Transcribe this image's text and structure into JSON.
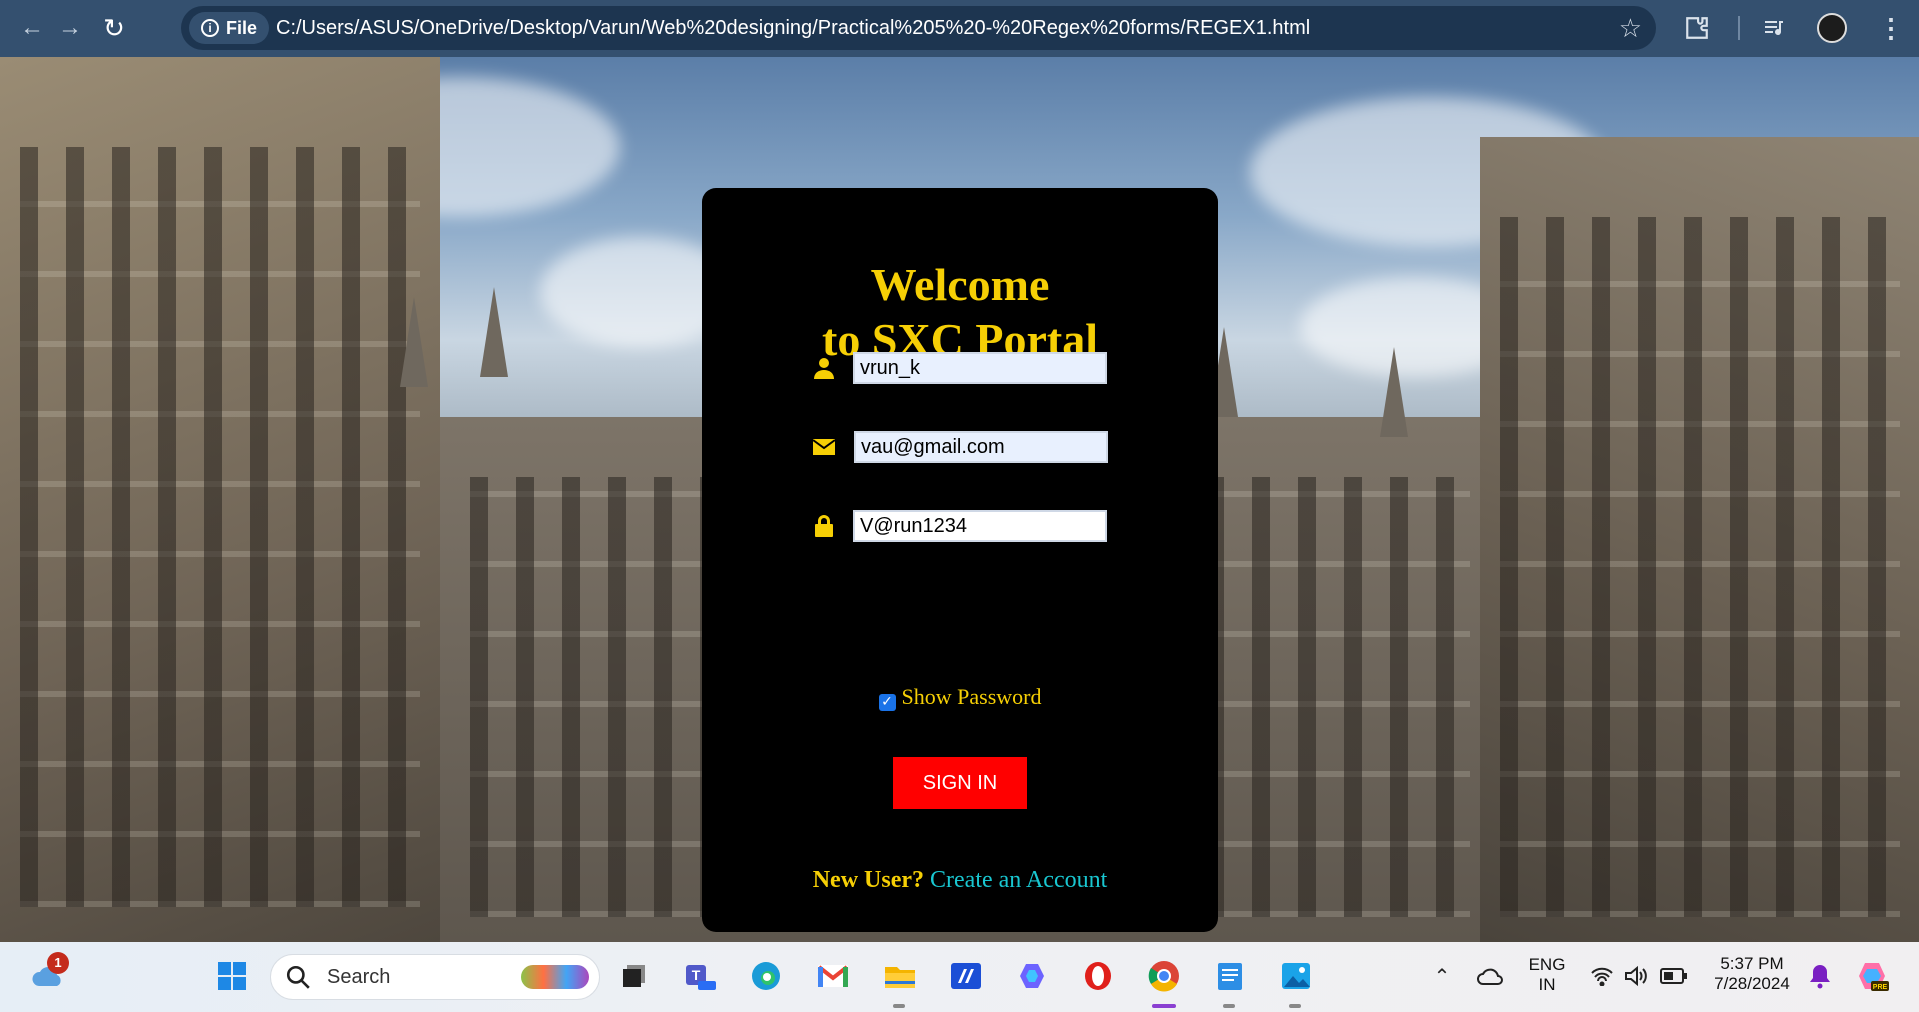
{
  "browser": {
    "file_chip_label": "File",
    "url": "C:/Users/ASUS/OneDrive/Desktop/Varun/Web%20designing/Practical%205%20-%20Regex%20forms/REGEX1.html"
  },
  "login": {
    "title_line1": "Welcome",
    "title_line2": "to SXC Portal",
    "username_value": "vrun_k",
    "email_value": "vau@gmail.com",
    "password_value": "V@run1234",
    "show_password_label": "Show Password",
    "show_password_checked": true,
    "signin_label": "SIGN IN",
    "new_user_text": "New User?",
    "create_account_link": "Create an Account"
  },
  "colors": {
    "accent_yellow": "#f6cf05",
    "signin_red": "#ff0000",
    "link_cyan": "#19c6d0",
    "card_bg": "#000000",
    "chrome_bg": "#34506f"
  },
  "taskbar": {
    "search_placeholder": "Search",
    "weather_badge": "1",
    "language_line1": "ENG",
    "language_line2": "IN",
    "time": "5:37 PM",
    "date": "7/28/2024",
    "apps": [
      "start-icon",
      "search",
      "task-view-icon",
      "teams-icon",
      "edge-icon",
      "gmail-icon",
      "file-explorer-icon",
      "ms365-icon",
      "copilot-icon",
      "opera-icon",
      "chrome-icon",
      "notepad-icon",
      "photos-icon"
    ]
  }
}
